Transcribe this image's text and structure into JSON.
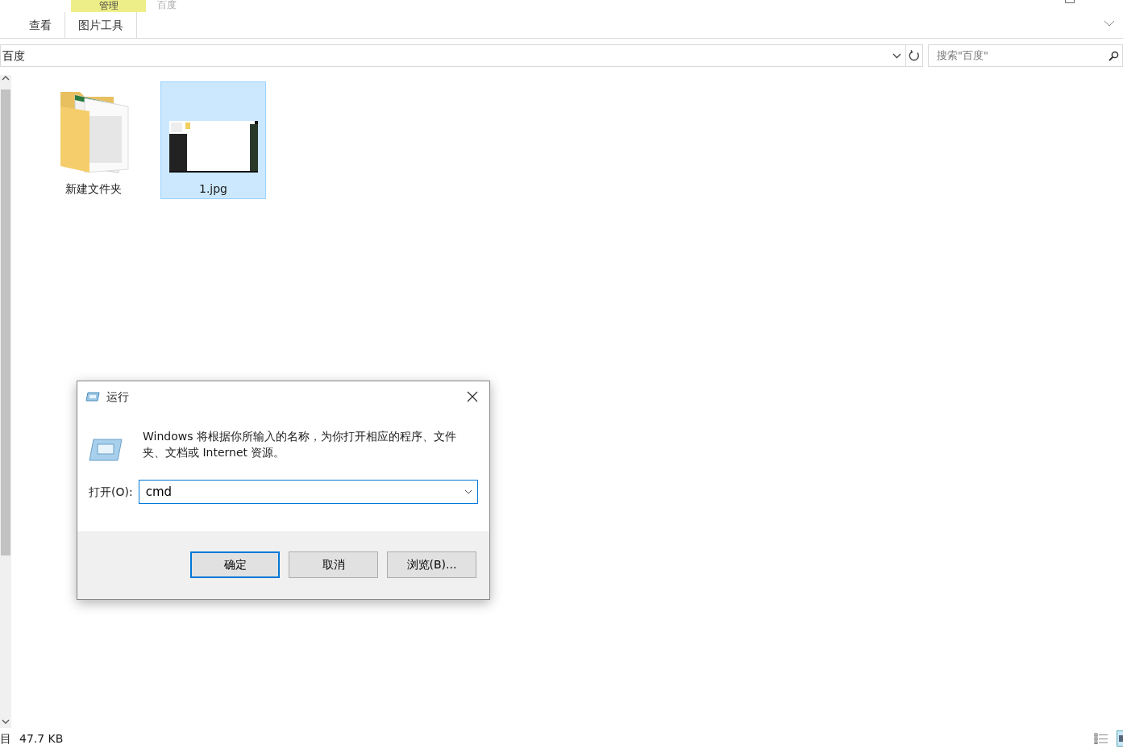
{
  "ribbon": {
    "context_group": "管理",
    "window_title": "百度",
    "tabs": [
      {
        "label": "查看",
        "selected": false
      },
      {
        "label": "图片工具",
        "selected": true
      }
    ]
  },
  "address_bar": {
    "path": "百度"
  },
  "search": {
    "placeholder": "搜索\"百度\""
  },
  "files": [
    {
      "name": "新建文件夹",
      "kind": "folder",
      "selected": false
    },
    {
      "name": "1.jpg",
      "selected": true
    }
  ],
  "status_bar": {
    "item_count": "目",
    "size": "47.7 KB"
  },
  "dialog": {
    "title": "运行",
    "message": "Windows 将根据你所输入的名称，为你打开相应的程序、文件夹、文档或 Internet 资源。",
    "open_label": "打开(O):",
    "open_value": "cmd",
    "buttons": [
      {
        "label": "确定",
        "default": true
      },
      {
        "label": "取消",
        "default": false
      },
      {
        "label": "浏览(B)...",
        "default": false
      }
    ]
  }
}
